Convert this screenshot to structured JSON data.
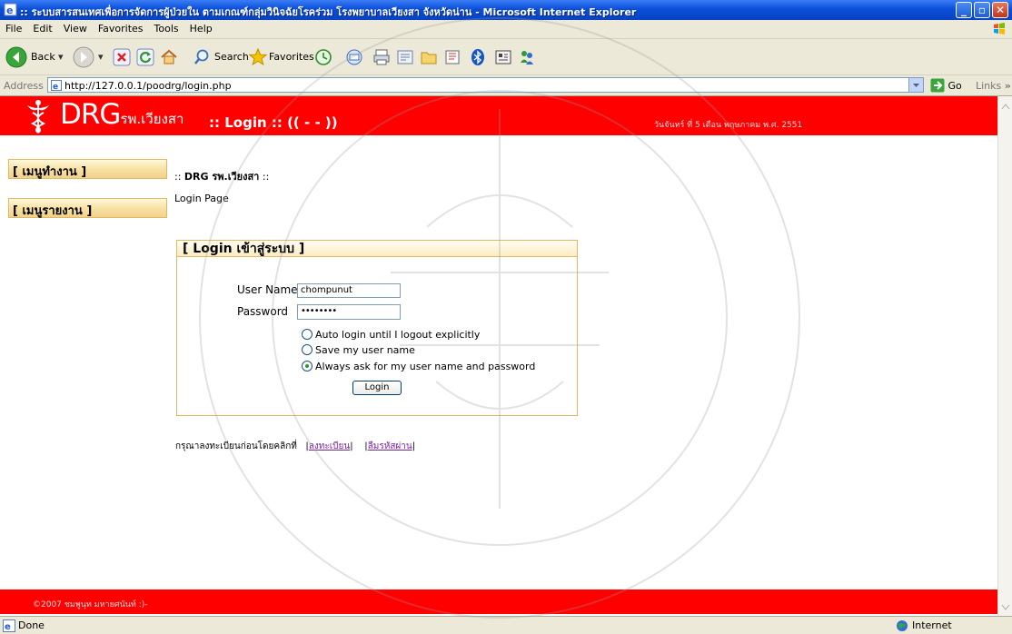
{
  "window": {
    "title": ":: ระบบสารสนเทศเพื่อการจัดการผู้ป่วยใน ตามเกณฑ์กลุ่มวินิจฉัยโรคร่วม โรงพยาบาลเวียงสา จังหวัดน่าน - Microsoft Internet Explorer"
  },
  "menu": [
    "File",
    "Edit",
    "View",
    "Favorites",
    "Tools",
    "Help"
  ],
  "toolbar": {
    "back": "Back",
    "search": "Search",
    "favorites": "Favorites"
  },
  "address": {
    "label": "Address",
    "url": "http://127.0.0.1/poodrg/login.php",
    "go": "Go",
    "links": "Links"
  },
  "header": {
    "brand_main": "DRG",
    "brand_sub": "รพ.เวียงสา",
    "page_title": ":: Login :: (( - - ))",
    "date": "วันจันทร์ ที่ 5 เดือน พฤษภาคม พ.ศ. 2551"
  },
  "sidebar": {
    "work_menu": "[ เมนูทำงาน ]",
    "report_menu": "[ เมนูรายงาน ]"
  },
  "content": {
    "crumb_prefix": ":: ",
    "crumb_title": "DRG รพ.เวียงสา",
    "crumb_suffix": " ::",
    "page_label": "Login Page"
  },
  "login": {
    "panel_title": "[ Login เข้าสู่ระบบ ]",
    "username_label": "User Name",
    "username_value": "chompunut",
    "password_label": "Password",
    "password_value": "••••••••",
    "options": [
      "Auto login until I logout explicitly",
      "Save my user name",
      "Always ask for my user name and password"
    ],
    "selected_option": 2,
    "button": "Login"
  },
  "register": {
    "prompt": "กรุณาลงทะเบียนก่อนโดยคลิกที่",
    "register_link": "ลงทะเบียน",
    "forgot_link": "ลืมรหัสผ่าน"
  },
  "footer": {
    "text": "©2007 ชมพูนุท มหายศนันท์ :)-"
  },
  "status": {
    "left": "Done",
    "zone": "Internet"
  }
}
